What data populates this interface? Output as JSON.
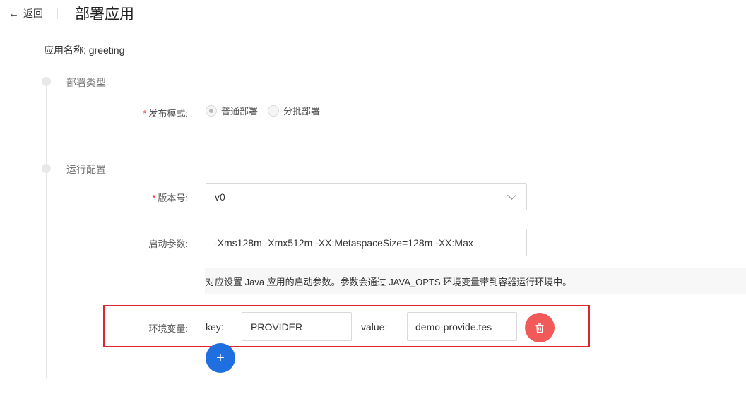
{
  "header": {
    "back_arrow": "←",
    "back_label": "返回",
    "title": "部署应用"
  },
  "app": {
    "name_label": "应用名称: greeting"
  },
  "sections": [
    {
      "title": "部署类型"
    },
    {
      "title": "运行配置"
    }
  ],
  "deploy_type": {
    "required_mark": "*",
    "mode_label": "发布模式:",
    "options": [
      {
        "label": "普通部署",
        "checked": true
      },
      {
        "label": "分批部署",
        "checked": false
      }
    ]
  },
  "run_config": {
    "version": {
      "required_mark": "*",
      "label": "版本号:",
      "value": "v0",
      "icon": "chevron-down-icon"
    },
    "params": {
      "label": "启动参数:",
      "value": "-Xms128m -Xmx512m -XX:MetaspaceSize=128m -XX:Max",
      "hint": "对应设置 Java 应用的启动参数。参数会通过 JAVA_OPTS 环境变量带到容器运行环境中。"
    },
    "env": {
      "label": "环境变量:",
      "key_label": "key:",
      "key_value": "PROVIDER",
      "value_label": "value:",
      "value_value": "demo-provide.tes",
      "delete_icon": "trash-icon",
      "add_icon": "plus-icon",
      "add_glyph": "+"
    }
  },
  "colors": {
    "highlight_border": "#e0232e",
    "delete_button": "#f25a5a",
    "add_button": "#1f6fe0",
    "required": "#f5222d"
  }
}
